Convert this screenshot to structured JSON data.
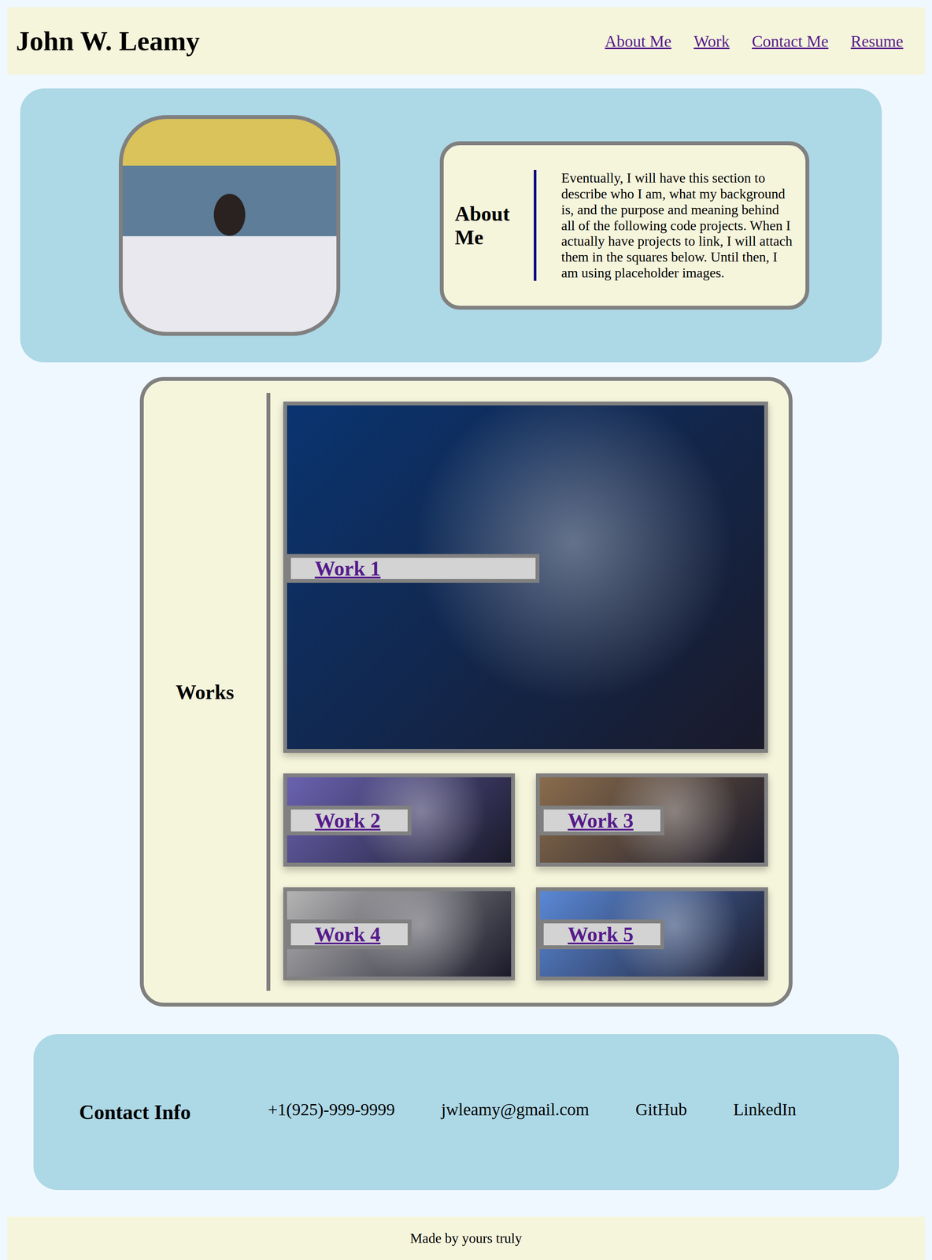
{
  "header": {
    "title": "John W. Leamy",
    "nav": [
      "About Me",
      "Work",
      "Contact Me",
      "Resume"
    ]
  },
  "about": {
    "heading": "About Me",
    "text": "Eventually, I will have this section to describe who I am, what my background is, and the purpose and meaning behind all of the following code projects. When I actually have projects to link, I will attach them in the squares below. Until then, I am using placeholder images."
  },
  "works": {
    "heading": "Works",
    "items": [
      {
        "label": "Work 1",
        "color": "#0a3470"
      },
      {
        "label": "Work 2",
        "color": "#6a62b0"
      },
      {
        "label": "Work 3",
        "color": "#8a6c4c"
      },
      {
        "label": "Work 4",
        "color": "#b4b4b4"
      },
      {
        "label": "Work 5",
        "color": "#5a88d6"
      }
    ]
  },
  "contact": {
    "heading": "Contact Info",
    "items": [
      "+1(925)-999-9999",
      "jwleamy@gmail.com",
      "GitHub",
      "LinkedIn"
    ]
  },
  "footer": {
    "text": "Made by yours truly"
  }
}
